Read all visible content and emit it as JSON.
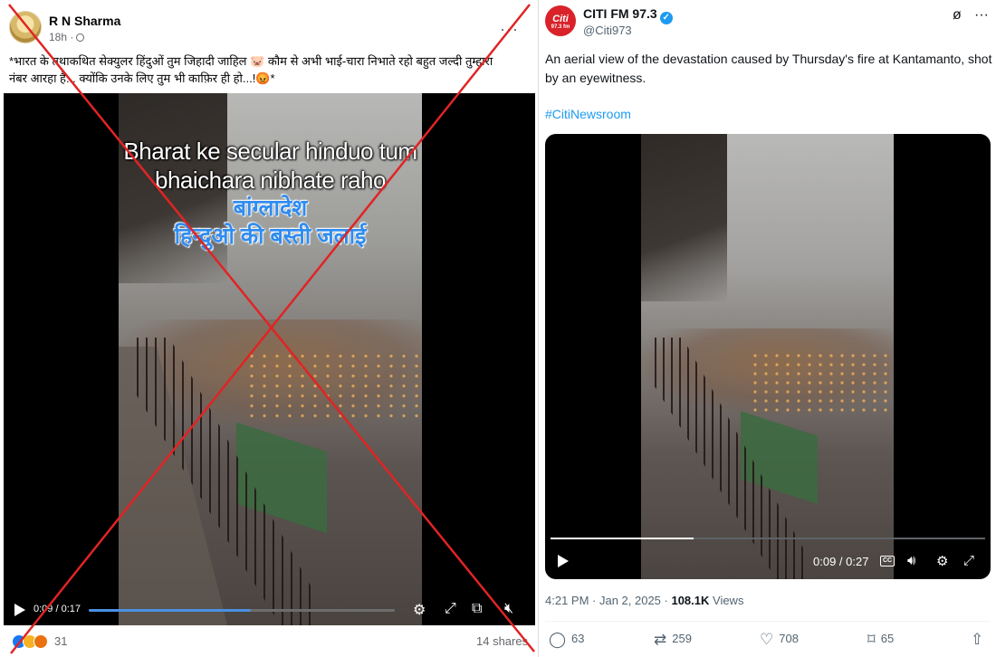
{
  "facebook_post": {
    "author": "R N Sharma",
    "time": "18h ·",
    "more": "···",
    "text_line1": "*भारत के तथाकथित सेक्युलर हिंदुओं तुम जिहादी जाहिल 🐷 कौम से अभी भाई-चारा निभाते रहो बहुत जल्दी तुम्हारा",
    "text_line2": "नंबर आरहा है... क्योंकि उनके लिए तुम भी काफ़िर ही हो...!😡*",
    "video": {
      "overlay_line1": "Bharat ke secular hinduo tum",
      "overlay_line2": "bhaichara nibhate raho",
      "overlay_line3": "बांग्लादेश",
      "overlay_line4": "हिन्दुओ की बस्ती जलाई",
      "timecode": "0:09 / 0:17",
      "progress": 0.53
    },
    "reaction_count": "31",
    "shares": "14 shares",
    "cross_color": "#e02424"
  },
  "tweet": {
    "display_name": "CITI FM 97.3",
    "verified_mark": "✓",
    "handle": "@Citi973",
    "avatar_text": "Citi",
    "avatar_sub": "97.3 fm",
    "text": "An aerial view of the devastation caused by Thursday's fire at Kantamanto, shot by an eyewitness.",
    "hashtag": "#CitiNewsroom",
    "video": {
      "timecode": "0:09 / 0:27",
      "cc": "CC",
      "progress": 0.33
    },
    "time": "4:21 PM · Jan 2, 2025 · ",
    "views_count": "108.1K",
    "views_label": " Views",
    "actions": {
      "replies": "63",
      "reposts": "259",
      "likes": "708",
      "bookmarks": "65"
    },
    "accent_color": "#1d9bf0"
  }
}
